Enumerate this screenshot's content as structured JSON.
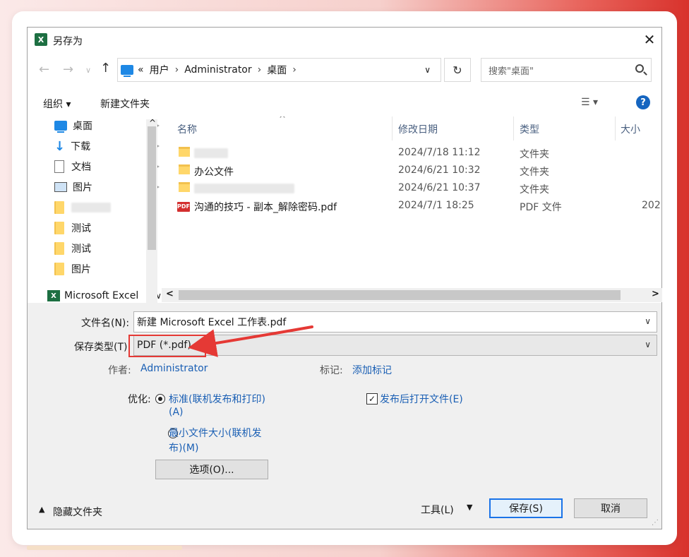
{
  "dialog": {
    "title": "另存为",
    "app_icon_letter": "X"
  },
  "nav": {
    "back": "←",
    "forward": "→",
    "recent": "∨",
    "up": "↑",
    "overflow": "«",
    "breadcrumb": [
      "用户",
      "Administrator",
      "桌面"
    ],
    "sep": "›",
    "dropdown": "∨",
    "refresh": "↻",
    "search_placeholder": "搜索\"桌面\""
  },
  "toolbar": {
    "organize": "组织 ▾",
    "new_folder": "新建文件夹",
    "view_menu": "☰ ▾",
    "help": "?"
  },
  "sidebar": {
    "items": [
      {
        "label": "桌面",
        "icon": "desktop-icon",
        "pinned": true
      },
      {
        "label": "下载",
        "icon": "download-icon",
        "pinned": true
      },
      {
        "label": "文档",
        "icon": "document-icon",
        "pinned": true
      },
      {
        "label": "图片",
        "icon": "pictures-icon",
        "pinned": true
      },
      {
        "label": "",
        "icon": "folder-icon",
        "pinned": false
      },
      {
        "label": "测试",
        "icon": "folder-icon",
        "pinned": false
      },
      {
        "label": "测试",
        "icon": "folder-icon",
        "pinned": false
      },
      {
        "label": "图片",
        "icon": "folder-icon",
        "pinned": false
      }
    ],
    "excel_item": "Microsoft Excel",
    "pin_glyph": "📌",
    "expand": "∨",
    "collapse": "^"
  },
  "filelist": {
    "columns": [
      "名称",
      "修改日期",
      "类型",
      "大小"
    ],
    "sort_indicator": "^",
    "rows": [
      {
        "name": "",
        "date": "2024/7/18 11:12",
        "type": "文件夹",
        "size": "",
        "kind": "folder"
      },
      {
        "name": "办公文件",
        "date": "2024/6/21 10:32",
        "type": "文件夹",
        "size": "",
        "kind": "folder"
      },
      {
        "name": "",
        "date": "2024/6/21 10:37",
        "type": "文件夹",
        "size": "",
        "kind": "folder"
      },
      {
        "name": "沟通的技巧 - 副本_解除密码.pdf",
        "date": "2024/7/1 18:25",
        "type": "PDF 文件",
        "size": "202",
        "kind": "pdf"
      }
    ],
    "scroll_left": "<",
    "scroll_right": ">"
  },
  "form": {
    "filename_label": "文件名(N):",
    "filename_value": "新建 Microsoft Excel 工作表.pdf",
    "filetype_label": "保存类型(T):",
    "filetype_value": "PDF (*.pdf)",
    "author_label": "作者:",
    "author_value": "Administrator",
    "tags_label": "标记:",
    "tags_value": "添加标记",
    "optimize_label": "优化:",
    "opt_standard_1": "标准(联机发布和打印)",
    "opt_standard_2": "(A)",
    "opt_min_1": "最小文件大小(联机发",
    "opt_min_2": "布)(M)",
    "open_after": "发布后打开文件(E)",
    "options_button": "选项(O)...",
    "hide_folders": "隐藏文件夹",
    "tools": "工具(L)",
    "save": "保存(S)",
    "cancel": "取消",
    "dropdown": "∨"
  },
  "annotation": {
    "box_color": "#e53935",
    "arrow_color": "#e53935"
  }
}
